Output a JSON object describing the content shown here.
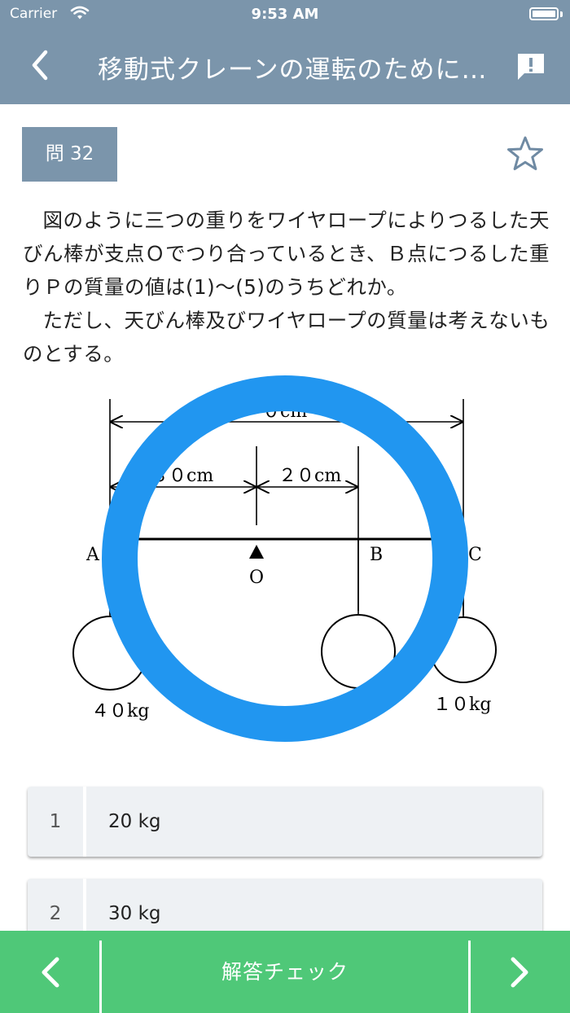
{
  "status_bar": {
    "carrier": "Carrier",
    "time": "9:53 AM"
  },
  "nav": {
    "title": "移動式クレーンの運転のために…",
    "back_icon": "chevron-left-icon",
    "report_icon": "report-icon"
  },
  "question": {
    "number_label": "問 32",
    "paragraph1": "図のように三つの重りをワイヤロープによりつるした天びん棒が支点Ｏでつり合っているとき、Ｂ点につるした重りＰの質量の値は(1)〜(5)のうちどれか。",
    "paragraph2": "ただし、天びん棒及びワイヤロープの質量は考えないものとする。"
  },
  "diagram": {
    "dim_total": "０cm",
    "dim_ao": "３０cm",
    "dim_ob": "２０cm",
    "label_a": "A",
    "label_b": "B",
    "label_c": "C",
    "label_o": "O",
    "weight_a": "４０kg",
    "weight_c": "１０kg",
    "overlay_color": "#2196f0"
  },
  "answers": [
    {
      "num": "1",
      "text": "20 kg"
    },
    {
      "num": "2",
      "text": "30 kg"
    }
  ],
  "bottom_bar": {
    "check_label": "解答チェック",
    "color": "#4fc878"
  }
}
